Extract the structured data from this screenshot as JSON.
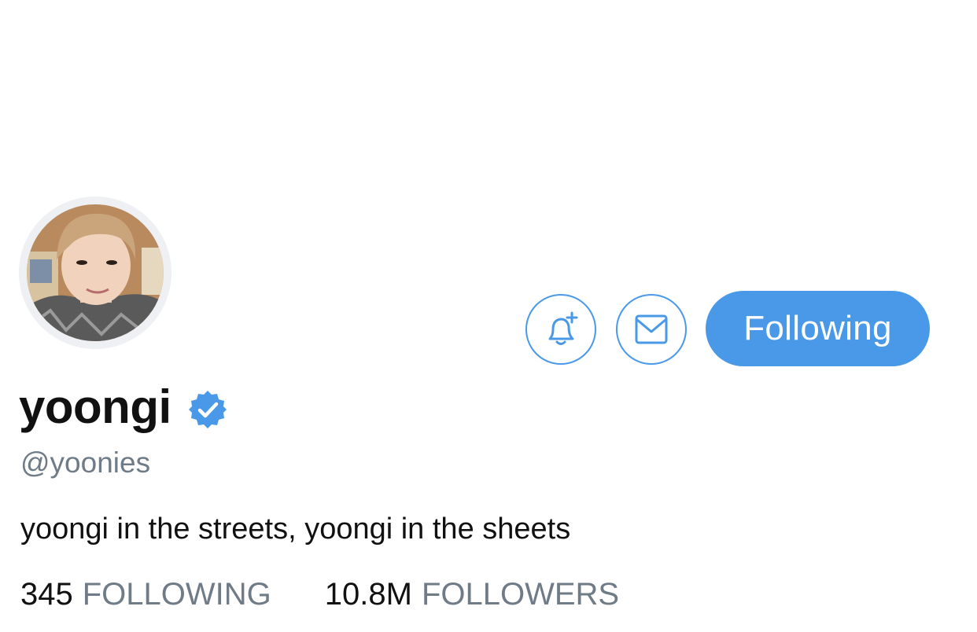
{
  "profile": {
    "display_name": "yoongi",
    "handle": "@yoonies",
    "bio": "yoongi in the streets, yoongi in the sheets",
    "verified": true
  },
  "actions": {
    "notify_icon": "bell-plus-icon",
    "message_icon": "envelope-icon",
    "follow_label": "Following"
  },
  "stats": {
    "following_count": "345",
    "following_label": "FOLLOWING",
    "followers_count": "10.8M",
    "followers_label": "FOLLOWERS"
  },
  "colors": {
    "accent": "#4a99e9",
    "muted_text": "#6f7b87",
    "text": "#111111",
    "background": "#ffffff"
  }
}
